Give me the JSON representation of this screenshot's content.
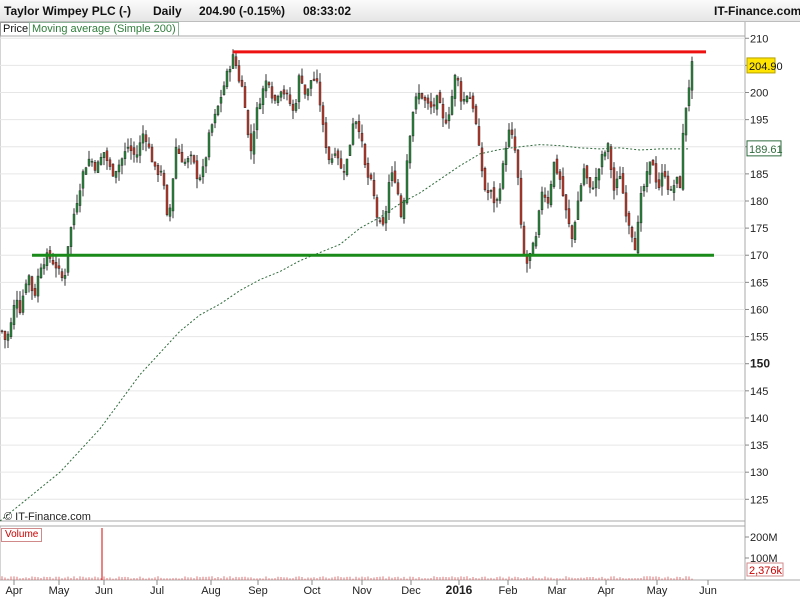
{
  "header": {
    "instrument": "Taylor Wimpey PLC (-)",
    "interval": "Daily",
    "change": "204.90 (-0.15%)",
    "time": "08:33:02",
    "brand": "IT-Finance.com"
  },
  "tags": {
    "price": "Price",
    "ma": "Moving average (Simple 200)",
    "volume": "Volume"
  },
  "watermark": "© IT-Finance.com",
  "chart_data": {
    "type": "candlestick",
    "title": "Taylor Wimpey PLC (-)",
    "last_price_label": "204.90",
    "ma_label": "189.61",
    "ylim": [
      121,
      213
    ],
    "y_ticks": [
      "125",
      "130",
      "135",
      "140",
      "145",
      "150",
      "155",
      "160",
      "165",
      "170",
      "175",
      "180",
      "185",
      "190",
      "195",
      "200",
      "205",
      "210"
    ],
    "x_labels": [
      "Apr",
      "May",
      "Jun",
      "Jul",
      "Aug",
      "Sep",
      "Oct",
      "Nov",
      "Dec",
      "2016",
      "Feb",
      "Mar",
      "Apr",
      "May",
      "Jun"
    ],
    "volume_ticks": [
      "200M",
      "100M"
    ],
    "volume_last_label": "2,376k",
    "resistance": 207.5,
    "support": 170,
    "price_path": [
      [
        0,
        157
      ],
      [
        6,
        154
      ],
      [
        12,
        158
      ],
      [
        16,
        163
      ],
      [
        20,
        160
      ],
      [
        28,
        167
      ],
      [
        34,
        162
      ],
      [
        40,
        168
      ],
      [
        48,
        170
      ],
      [
        56,
        168
      ],
      [
        64,
        165
      ],
      [
        68,
        172
      ],
      [
        72,
        176
      ],
      [
        78,
        181
      ],
      [
        84,
        186
      ],
      [
        90,
        188
      ],
      [
        96,
        186
      ],
      [
        104,
        189
      ],
      [
        112,
        185
      ],
      [
        120,
        187
      ],
      [
        128,
        190
      ],
      [
        136,
        188
      ],
      [
        144,
        193
      ],
      [
        150,
        189
      ],
      [
        156,
        185
      ],
      [
        162,
        186
      ],
      [
        168,
        175
      ],
      [
        176,
        190
      ],
      [
        184,
        187
      ],
      [
        192,
        188
      ],
      [
        198,
        184
      ],
      [
        204,
        186
      ],
      [
        210,
        193
      ],
      [
        216,
        196
      ],
      [
        222,
        200
      ],
      [
        228,
        204
      ],
      [
        234,
        207
      ],
      [
        238,
        203
      ],
      [
        244,
        200
      ],
      [
        250,
        188
      ],
      [
        256,
        196
      ],
      [
        262,
        200
      ],
      [
        268,
        203
      ],
      [
        274,
        198
      ],
      [
        280,
        201
      ],
      [
        288,
        199
      ],
      [
        294,
        196
      ],
      [
        300,
        204
      ],
      [
        306,
        199
      ],
      [
        312,
        203
      ],
      [
        318,
        201
      ],
      [
        324,
        192
      ],
      [
        330,
        187
      ],
      [
        336,
        190
      ],
      [
        342,
        185
      ],
      [
        348,
        188
      ],
      [
        354,
        196
      ],
      [
        360,
        193
      ],
      [
        366,
        185
      ],
      [
        372,
        183
      ],
      [
        378,
        176
      ],
      [
        384,
        175
      ],
      [
        390,
        185
      ],
      [
        396,
        184
      ],
      [
        402,
        176
      ],
      [
        408,
        190
      ],
      [
        414,
        198
      ],
      [
        420,
        200
      ],
      [
        426,
        198
      ],
      [
        432,
        197
      ],
      [
        438,
        199
      ],
      [
        444,
        194
      ],
      [
        450,
        197
      ],
      [
        456,
        204
      ],
      [
        462,
        198
      ],
      [
        468,
        200
      ],
      [
        474,
        197
      ],
      [
        480,
        188
      ],
      [
        486,
        181
      ],
      [
        490,
        182
      ],
      [
        496,
        179
      ],
      [
        502,
        185
      ],
      [
        508,
        193
      ],
      [
        514,
        191
      ],
      [
        518,
        184
      ],
      [
        522,
        172
      ],
      [
        526,
        168
      ],
      [
        530,
        170
      ],
      [
        536,
        173
      ],
      [
        542,
        182
      ],
      [
        548,
        180
      ],
      [
        554,
        187
      ],
      [
        560,
        184
      ],
      [
        566,
        178
      ],
      [
        572,
        173
      ],
      [
        578,
        180
      ],
      [
        584,
        186
      ],
      [
        590,
        182
      ],
      [
        596,
        184
      ],
      [
        602,
        188
      ],
      [
        608,
        190
      ],
      [
        614,
        182
      ],
      [
        620,
        185
      ],
      [
        626,
        178
      ],
      [
        632,
        174
      ],
      [
        636,
        171
      ],
      [
        640,
        180
      ],
      [
        646,
        184
      ],
      [
        652,
        188
      ],
      [
        658,
        182
      ],
      [
        664,
        186
      ],
      [
        670,
        181
      ],
      [
        676,
        184
      ],
      [
        680,
        183
      ],
      [
        684,
        195
      ],
      [
        688,
        200
      ],
      [
        692,
        205
      ]
    ],
    "ma_path": [
      [
        0,
        121
      ],
      [
        20,
        124
      ],
      [
        40,
        127
      ],
      [
        60,
        130
      ],
      [
        80,
        134
      ],
      [
        100,
        138
      ],
      [
        120,
        143
      ],
      [
        140,
        148
      ],
      [
        160,
        152
      ],
      [
        180,
        156
      ],
      [
        200,
        159
      ],
      [
        220,
        161
      ],
      [
        240,
        163.5
      ],
      [
        260,
        165.5
      ],
      [
        280,
        167
      ],
      [
        300,
        169
      ],
      [
        320,
        170.5
      ],
      [
        340,
        172
      ],
      [
        360,
        175
      ],
      [
        380,
        177
      ],
      [
        400,
        179.5
      ],
      [
        420,
        181.5
      ],
      [
        440,
        184
      ],
      [
        460,
        186.5
      ],
      [
        480,
        188.7
      ],
      [
        500,
        189.5
      ],
      [
        520,
        190
      ],
      [
        540,
        190.4
      ],
      [
        560,
        190.2
      ],
      [
        580,
        189.8
      ],
      [
        600,
        189.6
      ],
      [
        620,
        189.8
      ],
      [
        640,
        189.4
      ],
      [
        660,
        189.6
      ],
      [
        688,
        189.6
      ]
    ],
    "volume_spike": 300
  }
}
